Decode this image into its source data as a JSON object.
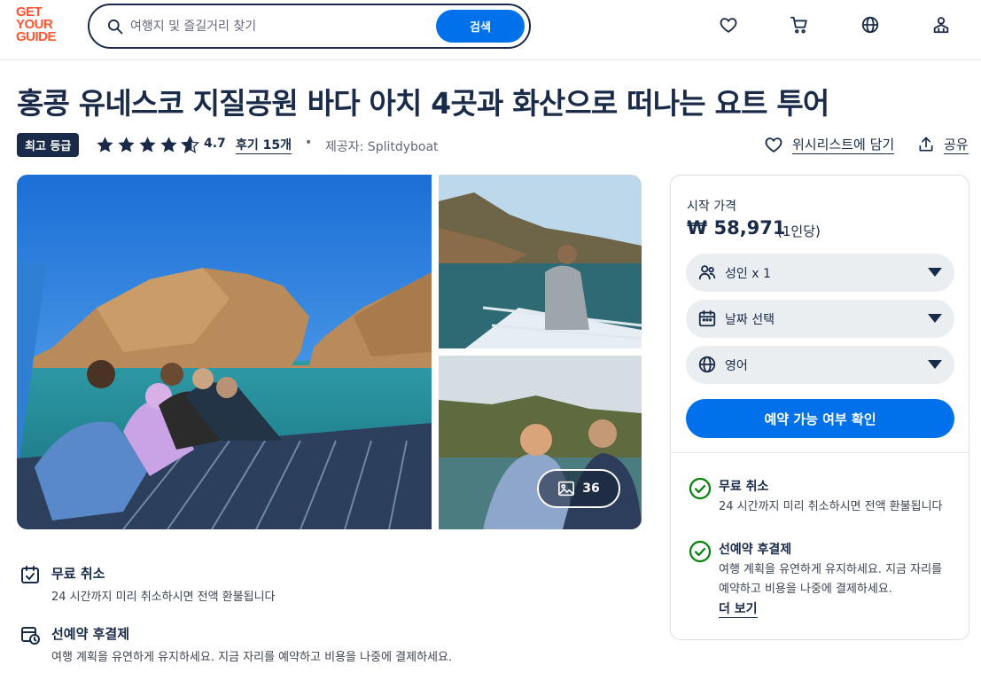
{
  "logo": {
    "line1": "GET",
    "line2": "YOUR",
    "line3": "GUIDE"
  },
  "search": {
    "placeholder": "여행지 및 즐길거리 찾기",
    "button": "검색"
  },
  "header_icons": [
    "heart-icon",
    "cart-icon",
    "globe-icon",
    "account-icon"
  ],
  "title": "홍콩 유네스코 지질공원 바다 아치 4곳과 화산으로 떠나는 요트 투어",
  "meta": {
    "badge": "최고 등급",
    "rating": "4.7",
    "rating_value": 4.7,
    "reviews": "후기 15개",
    "dot": "•",
    "provider": "제공자: Splitdyboat",
    "wishlist": "위시리스트에 담기",
    "share": "공유"
  },
  "gallery": {
    "photo_count": "36"
  },
  "features": [
    {
      "icon": "calendar-check-icon",
      "title": "무료 취소",
      "desc": "24 시간까지 미리 취소하시면 전액 환불됩니다"
    },
    {
      "icon": "calendar-clock-icon",
      "title": "선예약 후결제",
      "desc": "여행 계획을 유연하게 유지하세요. 지금 자리를 예약하고 비용을 나중에 결제하세요."
    }
  ],
  "booking": {
    "price_label": "시작 가격",
    "price": "₩ 58,971",
    "price_unit": "(1인당)",
    "participants": "성인 x 1",
    "date": "날짜 선택",
    "language": "영어",
    "cta": "예약 가능 여부 확인",
    "perks": [
      {
        "title": "무료 취소",
        "desc": "24 시간까지 미리 취소하시면 전액 환불됩니다"
      },
      {
        "title": "선예약 후결제",
        "desc": "여행 계획을 유연하게 유지하세요. 지금 자리를 예약하고 비용을 나중에 결제하세요."
      }
    ],
    "more": "더 보기"
  },
  "colors": {
    "brand": "#ff5533",
    "primary": "#0071eb",
    "text": "#1a2b49",
    "success": "#008009"
  }
}
